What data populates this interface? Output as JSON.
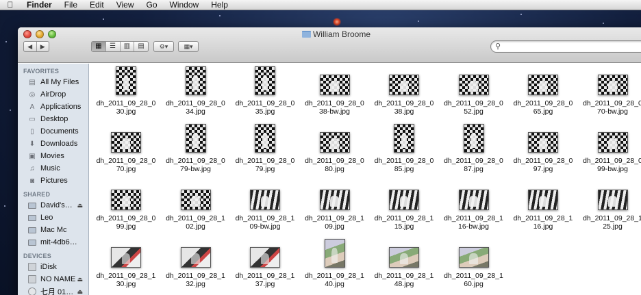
{
  "menubar": {
    "apple_icon": "apple-icon",
    "items": [
      {
        "label": "Finder",
        "app": true
      },
      {
        "label": "File"
      },
      {
        "label": "Edit"
      },
      {
        "label": "View"
      },
      {
        "label": "Go"
      },
      {
        "label": "Window"
      },
      {
        "label": "Help"
      }
    ]
  },
  "window": {
    "title": "William Broome",
    "toolbar": {
      "back_glyph": "◀",
      "forward_glyph": "▶",
      "view_icons": [
        "▦",
        "☰",
        "▥",
        "▤"
      ],
      "action_glyph": "⚙▾",
      "arrange_glyph": "▦▾",
      "search_value": ""
    }
  },
  "sidebar": {
    "favorites_header": "FAVORITES",
    "favorites": [
      {
        "label": "All My Files",
        "icon": "all-files-icon",
        "glyph": "▤"
      },
      {
        "label": "AirDrop",
        "icon": "airdrop-icon",
        "glyph": "◎"
      },
      {
        "label": "Applications",
        "icon": "applications-icon",
        "glyph": "A"
      },
      {
        "label": "Desktop",
        "icon": "desktop-icon",
        "glyph": "▭"
      },
      {
        "label": "Documents",
        "icon": "documents-icon",
        "glyph": "▯"
      },
      {
        "label": "Downloads",
        "icon": "downloads-icon",
        "glyph": "⬇"
      },
      {
        "label": "Movies",
        "icon": "movies-icon",
        "glyph": "▣"
      },
      {
        "label": "Music",
        "icon": "music-icon",
        "glyph": "♫"
      },
      {
        "label": "Pictures",
        "icon": "pictures-icon",
        "glyph": "◙"
      }
    ],
    "shared_header": "SHARED",
    "shared": [
      {
        "label": "David's…",
        "icon": "computer-icon",
        "eject": true
      },
      {
        "label": "Leo",
        "icon": "computer-icon"
      },
      {
        "label": "Mac Mc",
        "icon": "computer-icon"
      },
      {
        "label": "mit-4db6…",
        "icon": "computer-icon"
      }
    ],
    "devices_header": "DEVICES",
    "devices": [
      {
        "label": "iDisk",
        "icon": "idisk-icon"
      },
      {
        "label": "NO NAME",
        "icon": "drive-icon",
        "eject": true
      },
      {
        "label": "七月 01…",
        "icon": "disc-icon",
        "eject": true
      }
    ],
    "eject_glyph": "⏏"
  },
  "files": [
    {
      "line1": "dh_2011_09_28_0",
      "line2": "30.jpg",
      "shape": "portrait"
    },
    {
      "line1": "dh_2011_09_28_0",
      "line2": "34.jpg",
      "shape": "portrait"
    },
    {
      "line1": "dh_2011_09_28_0",
      "line2": "35.jpg",
      "shape": "portrait"
    },
    {
      "line1": "dh_2011_09_28_0",
      "line2": "38-bw.jpg",
      "shape": "landscape"
    },
    {
      "line1": "dh_2011_09_28_0",
      "line2": "38.jpg",
      "shape": "landscape"
    },
    {
      "line1": "dh_2011_09_28_0",
      "line2": "52.jpg",
      "shape": "landscape"
    },
    {
      "line1": "dh_2011_09_28_0",
      "line2": "65.jpg",
      "shape": "landscape"
    },
    {
      "line1": "dh_2011_09_28_0",
      "line2": "70-bw.jpg",
      "shape": "landscape"
    },
    {
      "line1": "dh_2011_09_28_0",
      "line2": "70.jpg",
      "shape": "landscape"
    },
    {
      "line1": "dh_2011_09_28_0",
      "line2": "79-bw.jpg",
      "shape": "portrait"
    },
    {
      "line1": "dh_2011_09_28_0",
      "line2": "79.jpg",
      "shape": "portrait"
    },
    {
      "line1": "dh_2011_09_28_0",
      "line2": "80.jpg",
      "shape": "landscape"
    },
    {
      "line1": "dh_2011_09_28_0",
      "line2": "85.jpg",
      "shape": "portrait"
    },
    {
      "line1": "dh_2011_09_28_0",
      "line2": "87.jpg",
      "shape": "portrait"
    },
    {
      "line1": "dh_2011_09_28_0",
      "line2": "97.jpg",
      "shape": "landscape"
    },
    {
      "line1": "dh_2011_09_28_0",
      "line2": "99-bw.jpg",
      "shape": "landscape"
    },
    {
      "line1": "dh_2011_09_28_0",
      "line2": "99.jpg",
      "shape": "landscape"
    },
    {
      "line1": "dh_2011_09_28_1",
      "line2": "02.jpg",
      "shape": "landscape"
    },
    {
      "line1": "dh_2011_09_28_1",
      "line2": "09-bw.jpg",
      "shape": "landscape stripe"
    },
    {
      "line1": "dh_2011_09_28_1",
      "line2": "09.jpg",
      "shape": "landscape stripe"
    },
    {
      "line1": "dh_2011_09_28_1",
      "line2": "15.jpg",
      "shape": "landscape stripe"
    },
    {
      "line1": "dh_2011_09_28_1",
      "line2": "16-bw.jpg",
      "shape": "landscape stripe"
    },
    {
      "line1": "dh_2011_09_28_1",
      "line2": "16.jpg",
      "shape": "landscape stripe"
    },
    {
      "line1": "dh_2011_09_28_1",
      "line2": "25.jpg",
      "shape": "landscape stripe"
    },
    {
      "line1": "dh_2011_09_28_1",
      "line2": "30.jpg",
      "shape": "landscape color1"
    },
    {
      "line1": "dh_2011_09_28_1",
      "line2": "32.jpg",
      "shape": "landscape color1"
    },
    {
      "line1": "dh_2011_09_28_1",
      "line2": "37.jpg",
      "shape": "landscape color1"
    },
    {
      "line1": "dh_2011_09_28_1",
      "line2": "40.jpg",
      "shape": "portrait color2"
    },
    {
      "line1": "dh_2011_09_28_1",
      "line2": "48.jpg",
      "shape": "landscape color2"
    },
    {
      "line1": "dh_2011_09_28_1",
      "line2": "60.jpg",
      "shape": "landscape color2"
    }
  ]
}
